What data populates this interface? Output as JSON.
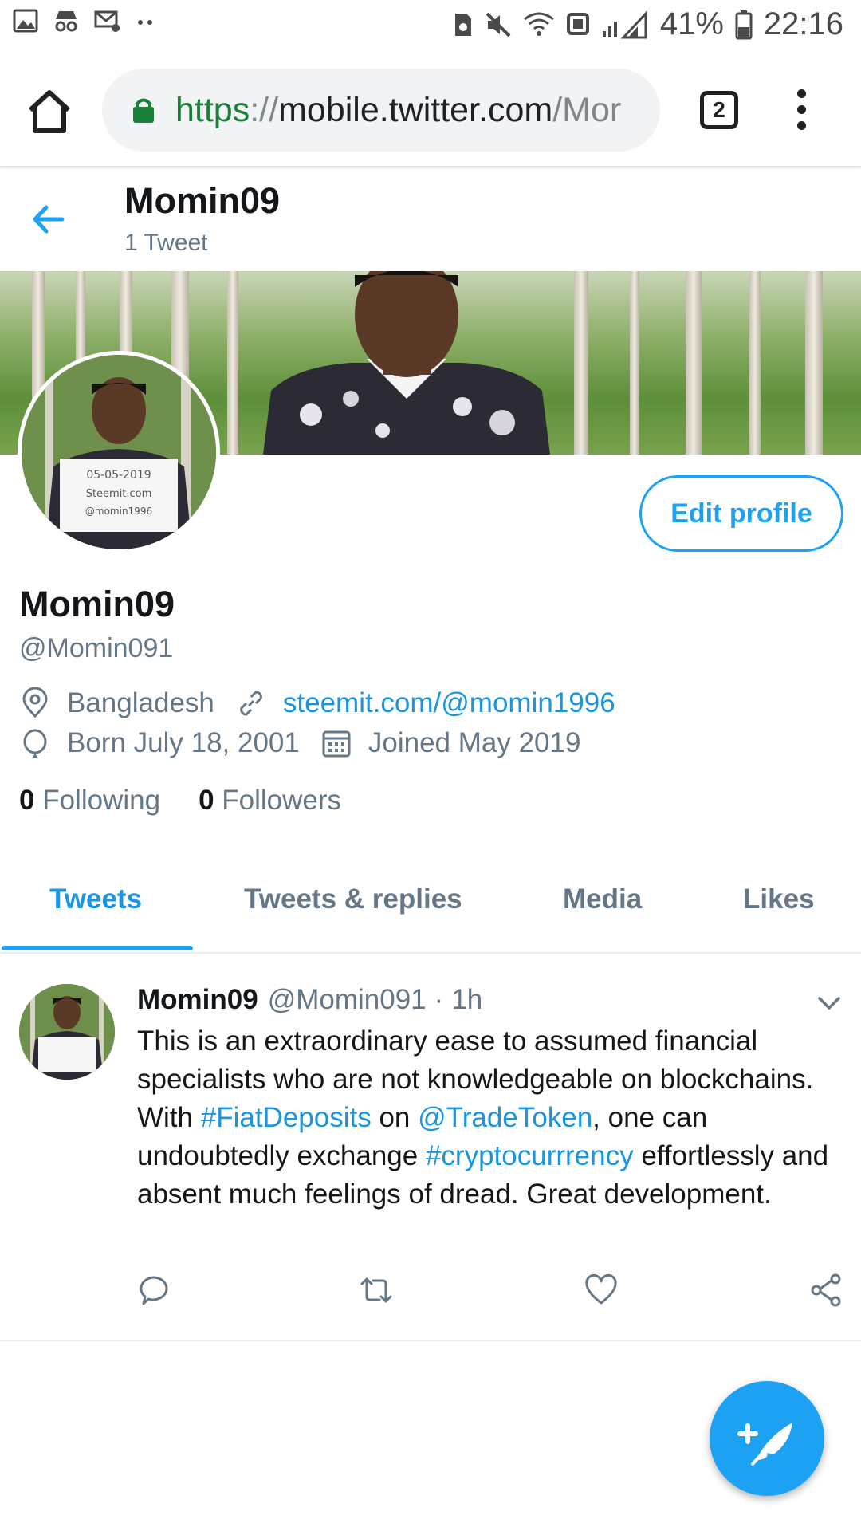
{
  "status_bar": {
    "battery": "41%",
    "time": "22:16"
  },
  "browser": {
    "url_scheme": "https",
    "url_sep": "://",
    "url_host": "mobile.twitter.com",
    "url_path": "/Mor",
    "tab_count": "2"
  },
  "header": {
    "name": "Momin09",
    "tweet_count": "1 Tweet"
  },
  "avatar_note": {
    "line1": "05-05-2019",
    "line2": "Steemit.com",
    "line3": "@momin1996"
  },
  "profile": {
    "edit_label": "Edit profile",
    "name": "Momin09",
    "handle": "@Momin091",
    "location": "Bangladesh",
    "website": "steemit.com/@momin1996",
    "born": "Born July 18, 2001",
    "joined": "Joined May 2019",
    "following_count": "0",
    "following_label": "Following",
    "followers_count": "0",
    "followers_label": "Followers"
  },
  "tabs": [
    {
      "label": "Tweets"
    },
    {
      "label": "Tweets & replies"
    },
    {
      "label": "Media"
    },
    {
      "label": "Likes"
    }
  ],
  "tweet": {
    "name": "Momin09",
    "handle": "@Momin091",
    "dot": "·",
    "time": "1h",
    "t1": "This is an extraordinary ease to assumed financial specialists who are not knowledgeable on blockchains. With ",
    "l1": "#FiatDeposits",
    "t2": " on ",
    "l2": "@TradeToken",
    "t3": ", one can undoubtedly exchange ",
    "l3": "#cryptocurrrency",
    "t4": " effortlessly and absent much feelings of dread. Great development."
  },
  "colors": {
    "twitter_blue": "#1da1f2",
    "link_blue": "#1b95e0",
    "secondary_text": "#657786",
    "url_green": "#188038"
  },
  "icons": [
    "gallery-icon",
    "incognito-icon",
    "settings-mail-icon",
    "notification-dots-icon",
    "sim-icon",
    "mute-icon",
    "wifi-icon",
    "data-icon",
    "signal-icon",
    "battery-icon",
    "home-icon",
    "lock-icon",
    "tabs-icon",
    "overflow-menu-icon",
    "back-arrow-icon",
    "location-icon",
    "link-icon",
    "balloon-icon",
    "calendar-icon",
    "chevron-down-icon",
    "reply-icon",
    "retweet-icon",
    "like-icon",
    "share-icon",
    "compose-tweet-icon"
  ]
}
